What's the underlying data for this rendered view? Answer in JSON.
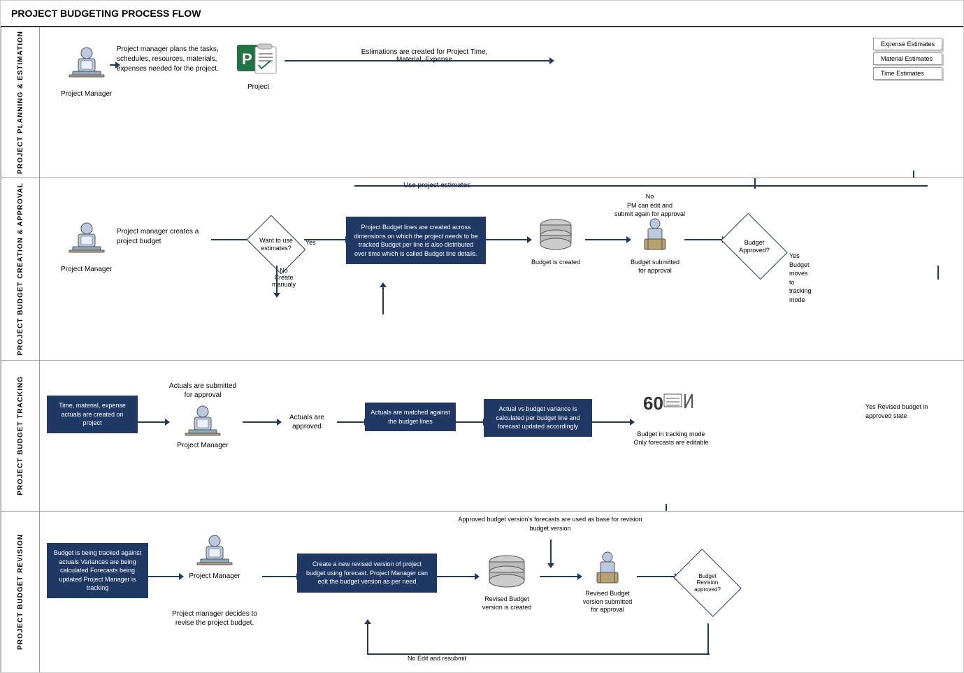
{
  "title": "PROJECT BUDGETING PROCESS FLOW",
  "lanes": [
    {
      "id": "lane1",
      "label": "PROJECT PLANNING & ESTIMATION",
      "minHeight": 215
    },
    {
      "id": "lane2",
      "label": "PROJECT BUDGET CREATION & APPROVAL",
      "minHeight": 260
    },
    {
      "id": "lane3",
      "label": "PROJECT BUDGET TRACKING",
      "minHeight": 215
    },
    {
      "id": "lane4",
      "label": "PROJECT BUDGET REVISION",
      "minHeight": 230
    }
  ],
  "lane1": {
    "actor_label": "Project Manager",
    "desc_text": "Project manager plans the tasks, schedules, resources, materials, expenses needed for the project.",
    "project_label": "Project",
    "estimation_text": "Estimations are created for Project Time, Material, Expense",
    "docs": [
      "Expense Estimates",
      "Material Estimates",
      "Time Estimates"
    ]
  },
  "lane2": {
    "actor_label": "Project Manager",
    "desc_text": "Project manager creates a project budget",
    "diamond_text": "Want to use estimates?",
    "yes_label": "Yes",
    "no_label": "No\nCreate manualy",
    "budget_lines_text": "Project Budget lines are created across dimensions on which the project needs to be tracked\nBudget per line is also distributed over time which is called Budget line details.",
    "budget_created_label": "Budget is created",
    "budget_submitted_label": "Budget submitted for approval",
    "approved_diamond_text": "Budget Approved?",
    "no_edit_text": "No\nPM can edit and submit again for approval",
    "yes_moves_text": "Yes\nBudget moves to tracking mode",
    "use_estimates_text": "Use project estimates"
  },
  "lane3": {
    "actuals_box_text": "Time, material, expense actuals are created on project",
    "submitted_text": "Actuals are submitted for approval",
    "actor_label": "Project Manager",
    "approved_text": "Actuals are approved",
    "matched_box_text": "Actuals are matched against the budget lines",
    "variance_box_text": "Actual vs budget variance is calculated per budget line and forecast updated accordingly",
    "tracking_label": "Budget in tracking mode\nOnly forecasts are editable",
    "revised_text": "Yes\nRevised budget in approved state"
  },
  "lane4": {
    "tracking_box_text": "Budget is being tracked against actuals\nVariances are being calculated\nForecasts being updated\nProject Manager is tracking",
    "actor_label": "Project Manager",
    "decides_text": "Project manager decides to revise the project budget.",
    "revised_version_box_text": "Create a new revised version of project budget using forecast.\nProject Manager can edit the budget version as per need",
    "revised_created_label": "Revised Budget version is created",
    "revised_submitted_label": "Revised Budget version submitted for approval",
    "approved_diamond_text": "Budget\nRevision\napproved?",
    "approved_forecasts_text": "Approved budget version's forecasts are used as base for revision budget version",
    "no_resubmit_text": "No Edit and resubmit"
  }
}
